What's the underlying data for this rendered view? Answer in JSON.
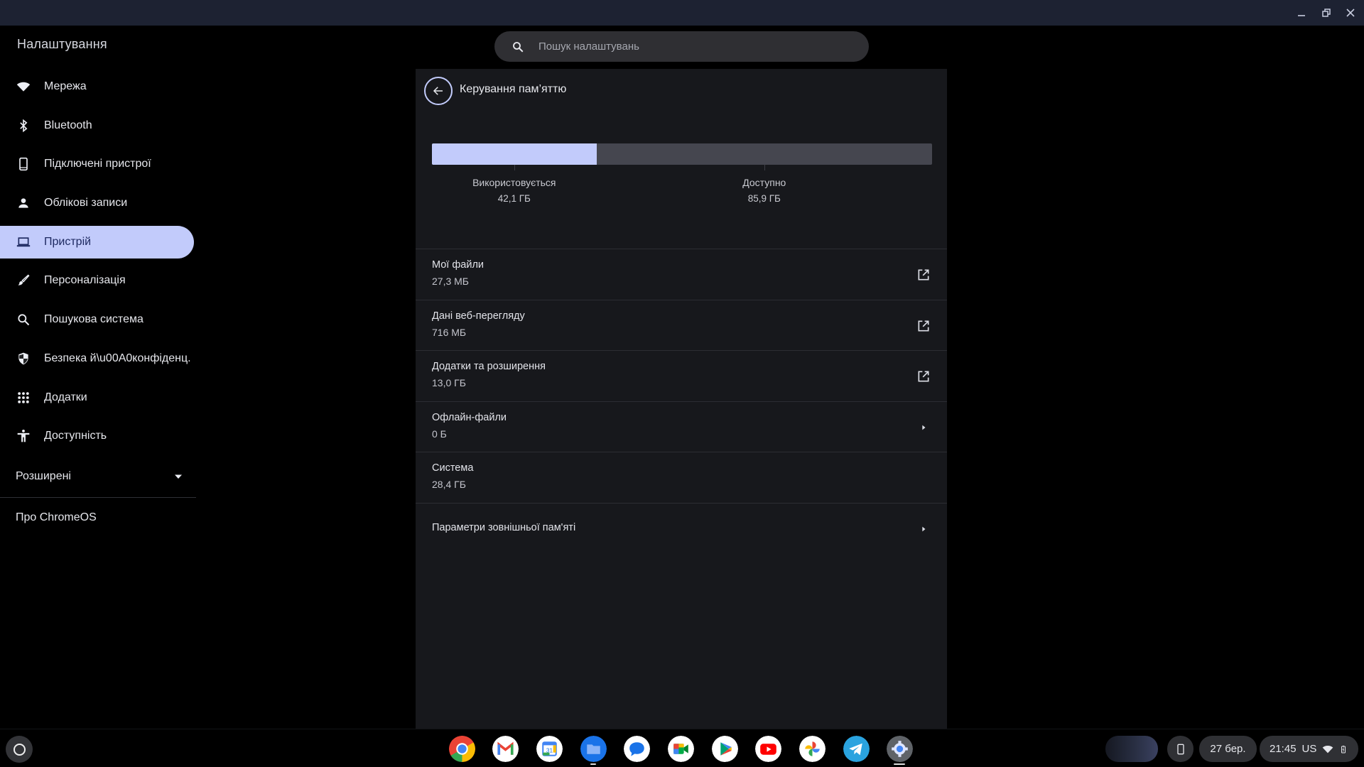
{
  "window": {
    "controls": [
      "minimize",
      "restore",
      "close"
    ]
  },
  "sidebar": {
    "title": "Налаштування",
    "items": [
      {
        "label": "Мережа",
        "icon": "wifi-icon",
        "active": false
      },
      {
        "label": "Bluetooth",
        "icon": "bluetooth-icon",
        "active": false
      },
      {
        "label": "Підключені пристрої",
        "icon": "phone-icon",
        "active": false
      },
      {
        "label": "Облікові записи",
        "icon": "person-icon",
        "active": false
      },
      {
        "label": "Пристрій",
        "icon": "laptop-icon",
        "active": true
      },
      {
        "label": "Персоналізація",
        "icon": "brush-icon",
        "active": false
      },
      {
        "label": "Пошукова система",
        "icon": "search-icon",
        "active": false
      },
      {
        "label": "Безпека й\\u00A0конфіденц.",
        "icon": "shield-icon",
        "active": false
      },
      {
        "label": "Додатки",
        "icon": "apps-grid-icon",
        "active": false
      },
      {
        "label": "Доступність",
        "icon": "accessibility-icon",
        "active": false
      }
    ],
    "advanced_label": "Розширені",
    "about_label": "Про ChromeOS"
  },
  "search": {
    "placeholder": "Пошук налаштувань",
    "value": ""
  },
  "page": {
    "title": "Керування пам’яттю",
    "storage": {
      "used_label": "Використовується",
      "used_value": "42,1 ГБ",
      "available_label": "Доступно",
      "available_value": "85,9 ГБ",
      "used_fraction": 0.329,
      "colors": {
        "used": "#c2cbfb",
        "available": "#45464f"
      }
    },
    "rows": [
      {
        "title": "Мої файли",
        "subtitle": "27,3 МБ",
        "action": "external-link"
      },
      {
        "title": "Дані веб-перегляду",
        "subtitle": "716 МБ",
        "action": "external-link"
      },
      {
        "title": "Додатки та розширення",
        "subtitle": "13,0 ГБ",
        "action": "external-link"
      },
      {
        "title": "Офлайн-файли",
        "subtitle": "0 Б",
        "action": "arrow"
      },
      {
        "title": "Система",
        "subtitle": "28,4 ГБ",
        "action": "none"
      },
      {
        "title": "Параметри зовнішньої пам'яті",
        "subtitle": "",
        "action": "arrow"
      }
    ]
  },
  "shelf": {
    "apps": [
      {
        "name": "Chrome",
        "icon": "chrome-icon",
        "running": false
      },
      {
        "name": "Gmail",
        "icon": "gmail-icon",
        "running": false
      },
      {
        "name": "Calendar",
        "icon": "calendar-icon",
        "calendar_day": "31",
        "running": false
      },
      {
        "name": "Files",
        "icon": "files-icon",
        "running": true
      },
      {
        "name": "Messages",
        "icon": "messages-icon",
        "running": false
      },
      {
        "name": "Meet",
        "icon": "meet-icon",
        "running": false
      },
      {
        "name": "Play Store",
        "icon": "play-store-icon",
        "running": false
      },
      {
        "name": "YouTube",
        "icon": "youtube-icon",
        "running": false
      },
      {
        "name": "Photos",
        "icon": "photos-icon",
        "running": false
      },
      {
        "name": "Telegram",
        "icon": "telegram-icon",
        "running": false
      },
      {
        "name": "Settings",
        "icon": "settings-icon",
        "running": true
      }
    ],
    "tray": {
      "date": "27 бер.",
      "time": "21:45",
      "input_method": "US"
    }
  }
}
